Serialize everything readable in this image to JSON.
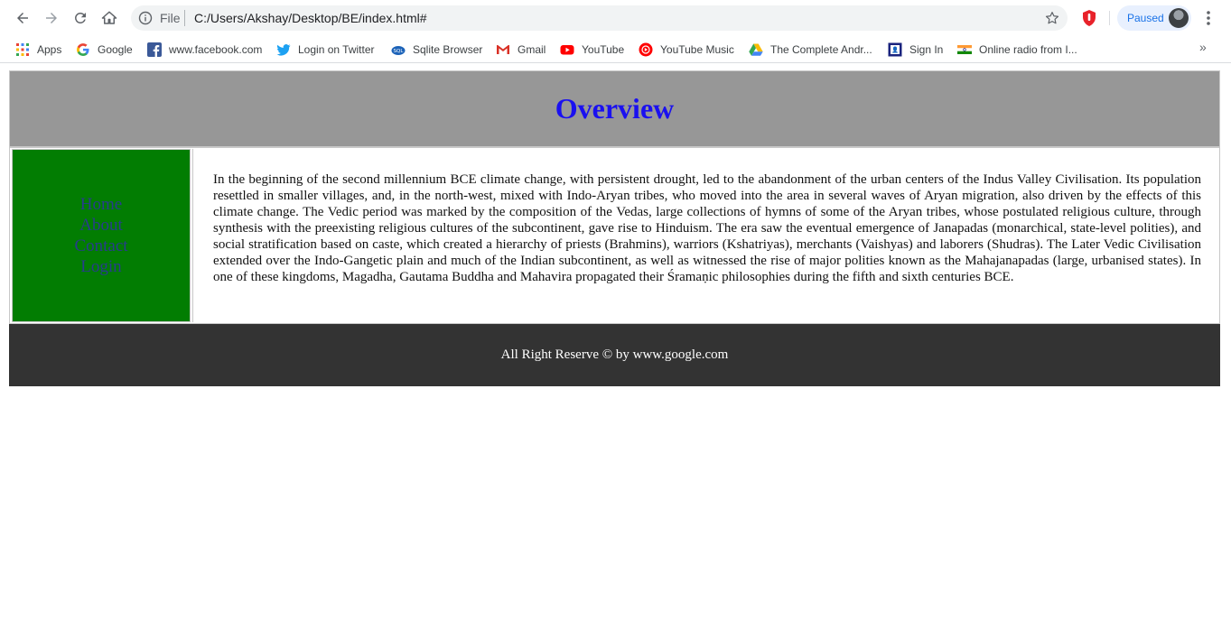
{
  "browser": {
    "file_label": "File",
    "url": "C:/Users/Akshay/Desktop/BE/index.html#",
    "profile_status": "Paused",
    "bookmarks": [
      {
        "label": "Apps",
        "icon": "apps-grid-icon"
      },
      {
        "label": "Google",
        "icon": "google-icon"
      },
      {
        "label": "www.facebook.com",
        "icon": "facebook-icon"
      },
      {
        "label": "Login on Twitter",
        "icon": "twitter-icon"
      },
      {
        "label": "Sqlite Browser",
        "icon": "sqlite-icon"
      },
      {
        "label": "Gmail",
        "icon": "gmail-icon"
      },
      {
        "label": "YouTube",
        "icon": "youtube-icon"
      },
      {
        "label": "YouTube Music",
        "icon": "youtube-music-icon"
      },
      {
        "label": "The Complete Andr...",
        "icon": "google-drive-icon"
      },
      {
        "label": "Sign In",
        "icon": "sign-in-icon"
      },
      {
        "label": "Online radio from I...",
        "icon": "india-flag-icon"
      }
    ],
    "more_bookmarks": "»"
  },
  "page": {
    "title": "Overview",
    "nav": [
      "Home",
      "About",
      "Contact",
      "Login"
    ],
    "body_text": "In the beginning of the second millennium BCE climate change, with persistent drought, led to the abandonment of the urban centers of the Indus Valley Civilisation. Its population resettled in smaller villages, and, in the north-west, mixed with Indo-Aryan tribes, who moved into the area in several waves of Aryan migration, also driven by the effects of this climate change. The Vedic period was marked by the composition of the Vedas, large collections of hymns of some of the Aryan tribes, whose postulated religious culture, through synthesis with the preexisting religious cultures of the subcontinent, gave rise to Hinduism. The era saw the eventual emergence of Janapadas (monarchical, state-level polities), and social stratification based on caste, which created a hierarchy of priests (Brahmins), warriors (Kshatriyas), merchants (Vaishyas) and laborers (Shudras). The Later Vedic Civilisation extended over the Indo-Gangetic plain and much of the Indian subcontinent, as well as witnessed the rise of major polities known as the Mahajanapadas (large, urbanised states). In one of these kingdoms, Magadha, Gautama Buddha and Mahavira propagated their Śramaṇic philosophies during the fifth and sixth centuries BCE.",
    "footer": "All Right Reserve © by www.google.com"
  },
  "colors": {
    "header_bg": "#979797",
    "title": "#1a10f0",
    "sidenav_bg": "#027d02",
    "nav_link": "#283c8c",
    "footer_bg": "#333333"
  }
}
